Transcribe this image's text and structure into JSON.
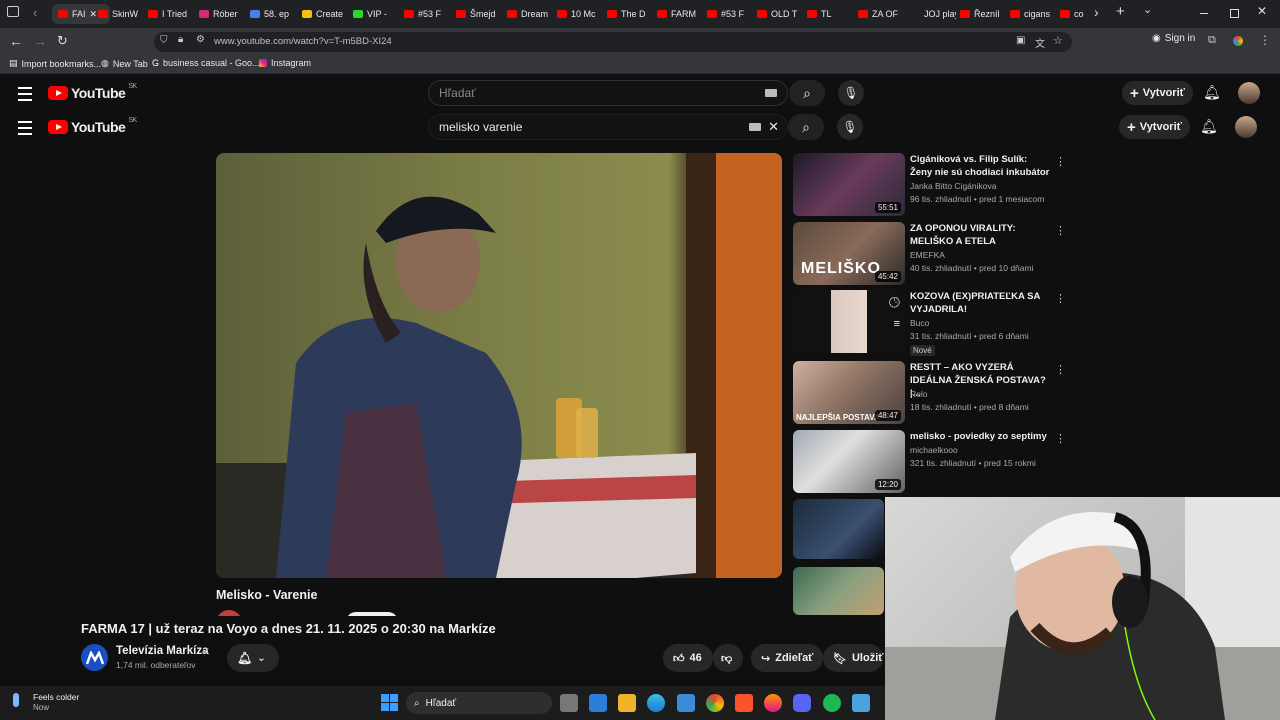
{
  "browser": {
    "tabs": [
      {
        "label": "FAI",
        "color": "#ff0000",
        "active": true
      },
      {
        "label": "SkinW",
        "color": "#ff0000"
      },
      {
        "label": "I Tried",
        "color": "#ff0000"
      },
      {
        "label": "Róber",
        "color": "#d62976"
      },
      {
        "label": "58. ep",
        "color": "#4a7ee8"
      },
      {
        "label": "Create",
        "color": "#f4c20d"
      },
      {
        "label": "VIP -",
        "color": "#2bd62b"
      },
      {
        "label": "#53 F",
        "color": "#ff0000"
      },
      {
        "label": "Šmejd",
        "color": "#ff0000"
      },
      {
        "label": "Dream",
        "color": "#ff0000"
      },
      {
        "label": "10 Mc",
        "color": "#ff0000"
      },
      {
        "label": "The D",
        "color": "#ff0000"
      },
      {
        "label": "FARM",
        "color": "#ff0000"
      },
      {
        "label": "#53 F",
        "color": "#ff0000"
      },
      {
        "label": "OLD T",
        "color": "#ff0000"
      },
      {
        "label": "TL",
        "color": "#ff0000"
      },
      {
        "label": "ZA OF",
        "color": "#ff0000"
      },
      {
        "label": "JOJ play",
        "color": "#202124"
      },
      {
        "label": "Řezníl",
        "color": "#ff0000"
      },
      {
        "label": "cigans",
        "color": "#ff0000"
      },
      {
        "label": "co",
        "color": "#ff0000"
      }
    ],
    "url": "www.youtube.com/watch?v=T-m5BD-XI24",
    "sign_in": "Sign in",
    "bookmarks": [
      "Import bookmarks...",
      "New Tab",
      "business casual - Goo...",
      "Instagram"
    ]
  },
  "youtube": {
    "logo": "YouTube",
    "region": "SK",
    "search_placeholder": "Hľadať",
    "search_query": "melisko varenie",
    "create_label": "Vytvoriť",
    "video_title": "Melisko - Varenie",
    "main_title": "FARMA 17 | už teraz na Voyo a dnes 21. 11. 2025 o 20:30 na Markíze",
    "channel": "Televízia Markíza",
    "subscribers": "1,74 mil. odberateľov",
    "likes": "46",
    "share_label": "Zdieľať",
    "save_label": "Uložiť"
  },
  "related": [
    {
      "title": "Cigániková vs. Filip Sulík: Ženy nie sú chodiaci inkubátor",
      "channel": "Janka Bitto Cigánikova",
      "meta": "96 tis. zhliadnutí • pred 1 mesiacom",
      "duration": "55:51"
    },
    {
      "title": "ZA OPONOU VIRALITY: MELIŠKO A ETELA",
      "channel": "EMEFKA",
      "meta": "40 tis. zhliadnutí • pred 10 dňami",
      "duration": "45:42"
    },
    {
      "title": "KOZOVA (EX)PRIATEĽKA SA VYJADRILA!",
      "channel": "Buco",
      "meta": "31 tis. zhliadnutí • pred 6 dňami",
      "badge": "Nové"
    },
    {
      "title": "RESTT – AKO VYZERÁ IDEÁLNA ŽENSKÁ POSTAVA? |...",
      "channel": "Relo",
      "meta": "18 tis. zhliadnutí • pred 8 dňami",
      "duration": "48:47"
    },
    {
      "title": "melisko - poviedky zo septimy",
      "channel": "michaelkooo",
      "meta": "321 tis. zhliadnutí • pred 15 rokmi",
      "duration": "12:20"
    }
  ],
  "thumb_text": {
    "melisko": "MELIŠKO",
    "najlepsia": "NAJLEPŠIA POSTAVA"
  },
  "taskbar": {
    "weather_line1": "Feels colder",
    "weather_line2": "Now",
    "search_label": "Hľadať"
  }
}
